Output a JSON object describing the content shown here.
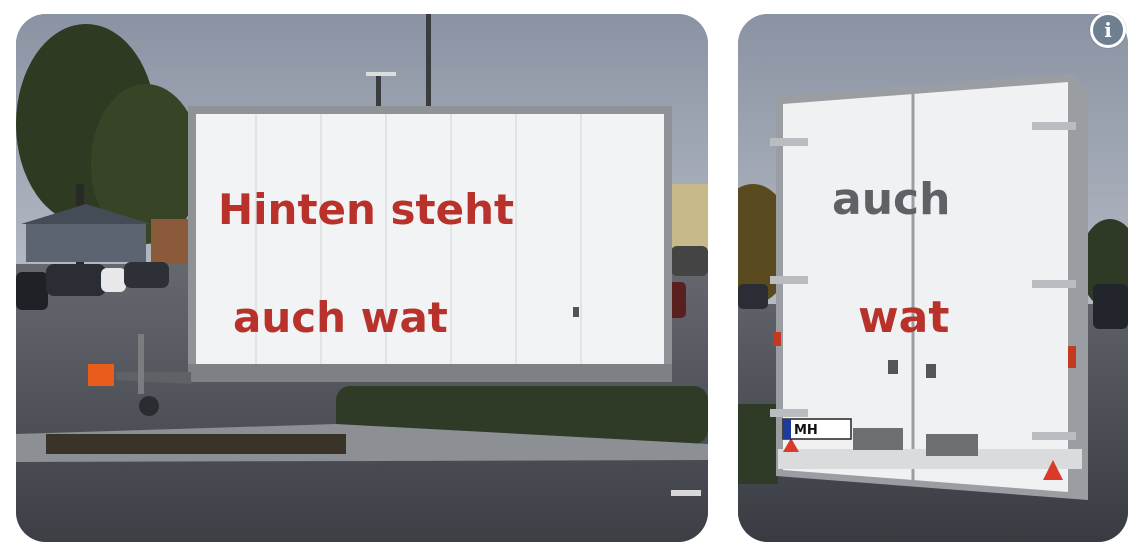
{
  "photos": [
    {
      "side": "left",
      "lines": [
        "Hinten steht",
        "auch wat"
      ]
    },
    {
      "side": "right",
      "lines": [
        "auch",
        "wat"
      ],
      "plate": "MH"
    }
  ],
  "info_icon": {
    "glyph": "i"
  },
  "colors": {
    "text_red": "#b8322b",
    "text_gray": "#5e6266",
    "trailer_white": "#f2f3f4",
    "sky": "#7b8494",
    "pavement": "#4a4d53"
  }
}
